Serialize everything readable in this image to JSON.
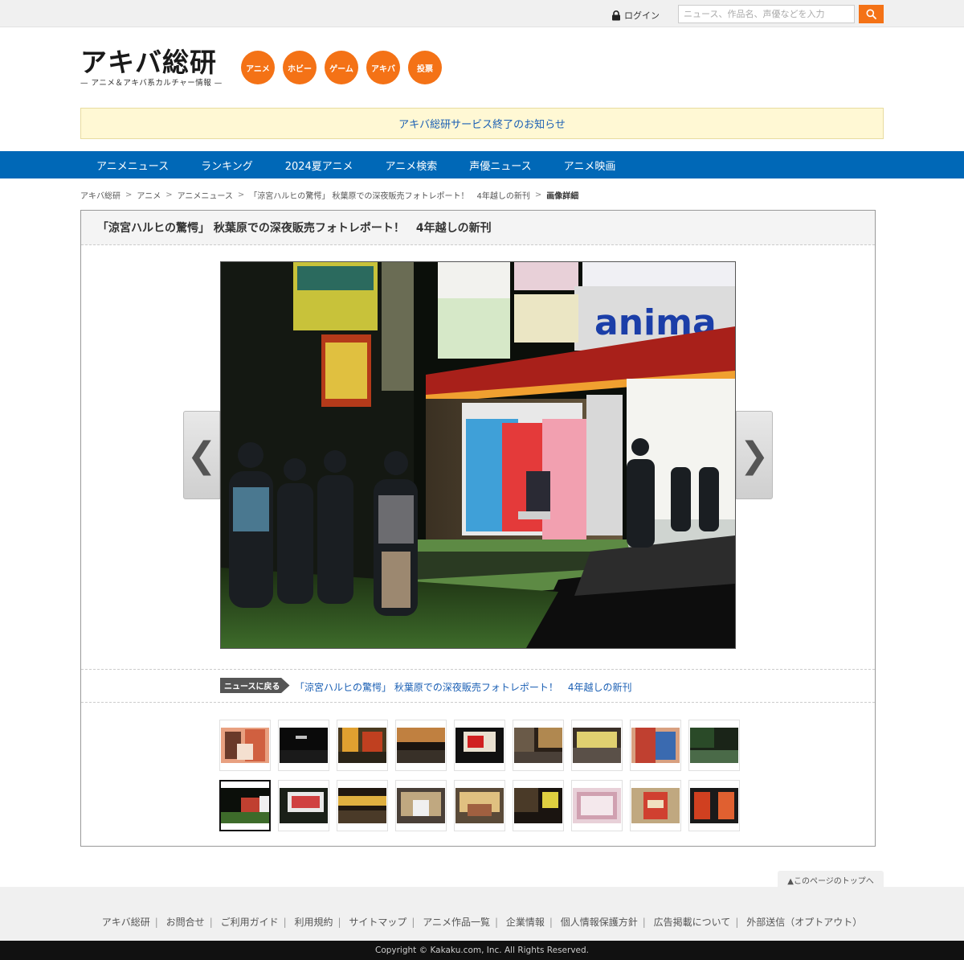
{
  "topbar": {
    "login_label": "ログイン",
    "search_placeholder": "ニュース、作品名、声優などを入力"
  },
  "header": {
    "logo_main": "アキバ総研",
    "logo_sub": "— アニメ＆アキバ系カルチャー情報 —",
    "categories": [
      "アニメ",
      "ホビー",
      "ゲーム",
      "アキバ",
      "投票"
    ]
  },
  "notice": {
    "text": "アキバ総研サービス終了のお知らせ"
  },
  "nav": {
    "items": [
      "アニメニュース",
      "ランキング",
      "2024夏アニメ",
      "アニメ検索",
      "声優ニュース",
      "アニメ映画"
    ]
  },
  "breadcrumb": {
    "items": [
      "アキバ総研",
      "アニメ",
      "アニメニュース",
      "「涼宮ハルヒの驚愕」 秋葉原での深夜販売フォトレポート！　4年越しの新刊"
    ],
    "current": "画像詳細"
  },
  "article": {
    "title": "「涼宮ハルヒの驚愕」 秋葉原での深夜販売フォトレポート！　4年越しの新刊",
    "prev_arrow": "❮",
    "next_arrow": "❯",
    "back_label": "ニュースに戻る",
    "back_link": "「涼宮ハルヒの驚愕」 秋葉原での深夜販売フォトレポート！　4年越しの新刊"
  },
  "thumbnails": {
    "selected_row": 1,
    "selected_index": 0
  },
  "footer": {
    "page_top": "▲このページのトップへ",
    "links": [
      "アキバ総研",
      "お問合せ",
      "ご利用ガイド",
      "利用規約",
      "サイトマップ",
      "アニメ作品一覧",
      "企業情報",
      "個人情報保護方針",
      "広告掲載について",
      "外部送信（オプトアウト）"
    ],
    "copyright": "Copyright © Kakaku.com, Inc. All Rights Reserved."
  },
  "colors": {
    "accent": "#f47216",
    "nav": "#0068b7",
    "link": "#1a5fb4"
  }
}
